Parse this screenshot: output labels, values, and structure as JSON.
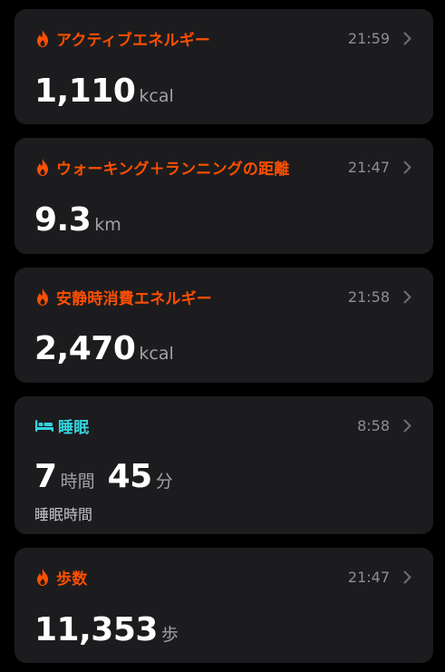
{
  "theme": {
    "energy_color": "#ff4f00",
    "sleep_color": "#35d4de",
    "secondary_text": "#8e8e93"
  },
  "cards": [
    {
      "title": "アクティブエネルギー",
      "time": "21:59",
      "icon": "flame-icon",
      "value": "1,110",
      "unit": "kcal"
    },
    {
      "title": "ウォーキング＋ランニングの距離",
      "time": "21:47",
      "icon": "flame-icon",
      "value": "9.3",
      "unit": "km"
    },
    {
      "title": "安静時消費エネルギー",
      "time": "21:58",
      "icon": "flame-icon",
      "value": "2,470",
      "unit": "kcal"
    },
    {
      "title": "睡眠",
      "time": "8:58",
      "icon": "bed-icon",
      "hours": "7",
      "hours_unit": "時間",
      "minutes": "45",
      "minutes_unit": "分",
      "subtitle": "睡眠時間"
    },
    {
      "title": "歩数",
      "time": "21:47",
      "icon": "flame-icon",
      "value": "11,353",
      "unit": "歩"
    }
  ]
}
